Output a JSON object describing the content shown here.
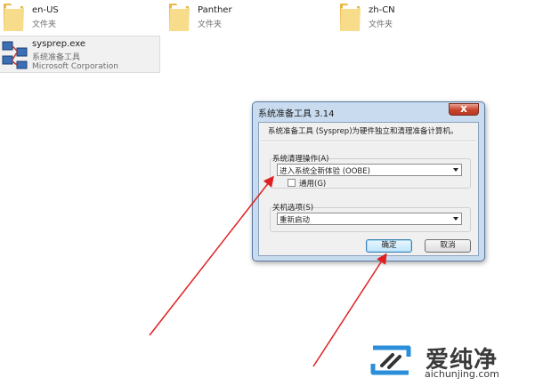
{
  "explorer": {
    "folders": [
      {
        "name": "en-US",
        "type": "文件夹"
      },
      {
        "name": "Panther",
        "type": "文件夹"
      },
      {
        "name": "zh-CN",
        "type": "文件夹"
      }
    ],
    "file": {
      "name": "sysprep.exe",
      "description": "系统准备工具",
      "company": "Microsoft Corporation"
    }
  },
  "dialog": {
    "title": "系统准备工具 3.14",
    "close_label": "x",
    "intro": "系统准备工具 (Sysprep)为硬件独立和清理准备计算机。",
    "cleanup_action": {
      "label": "系统清理操作(A)",
      "selected": "进入系统全新体验 (OOBE)",
      "generalize_label": "通用(G)",
      "generalize_checked": false
    },
    "shutdown_options": {
      "label": "关机选项(S)",
      "selected": "重新启动"
    },
    "ok_label": "确定",
    "cancel_label": "取消"
  },
  "watermark": {
    "brand_cn": "爱纯净",
    "url": "aichunjing.com"
  },
  "colors": {
    "annotation_arrow": "#e02020",
    "folder_yellow": "#f3d27a",
    "dialog_frame": "#c9dcef",
    "close_red": "#c8452c"
  },
  "icons": [
    "folder-icon",
    "sysprep-app-icon",
    "close-icon",
    "dropdown-arrow-icon",
    "aichunjing-logo-icon"
  ]
}
